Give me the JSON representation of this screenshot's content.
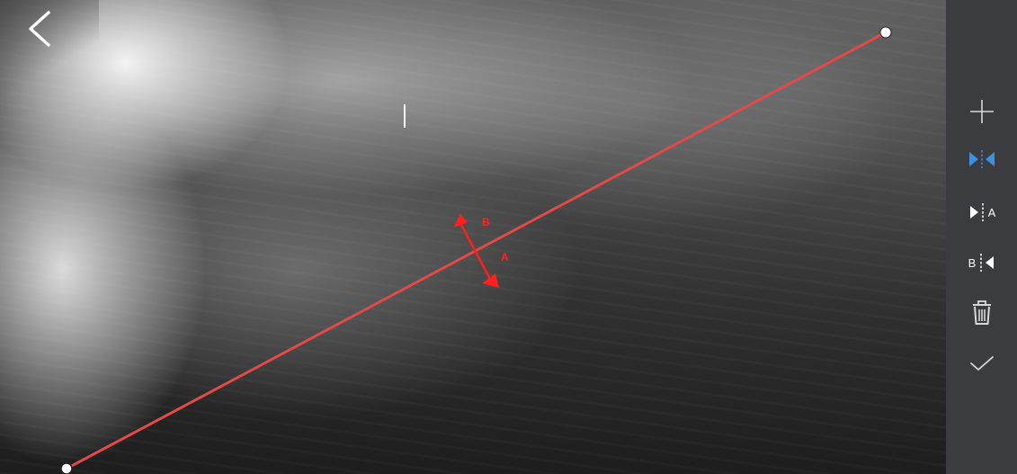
{
  "colors": {
    "line": "#e24a4a",
    "arrow": "#ff1f1f",
    "toolbar_bg": "#3b3c3f",
    "icon": "#d8d8d8",
    "icon_active": "#3d8fe0",
    "handle": "#ffffff"
  },
  "icons": {
    "back": "chevron-left-icon",
    "cursor": "text-cursor",
    "add": "plus-icon",
    "both_sides": "split-arrows-both-icon",
    "side_a": "arrow-to-a-icon",
    "side_b": "arrow-to-b-icon",
    "delete": "trash-icon",
    "confirm": "check-icon"
  },
  "marker": {
    "label_a": "A",
    "label_b": "B"
  },
  "toolbar": {
    "side_a_label": "A",
    "side_b_label": "B",
    "active_tool": "both_sides"
  }
}
